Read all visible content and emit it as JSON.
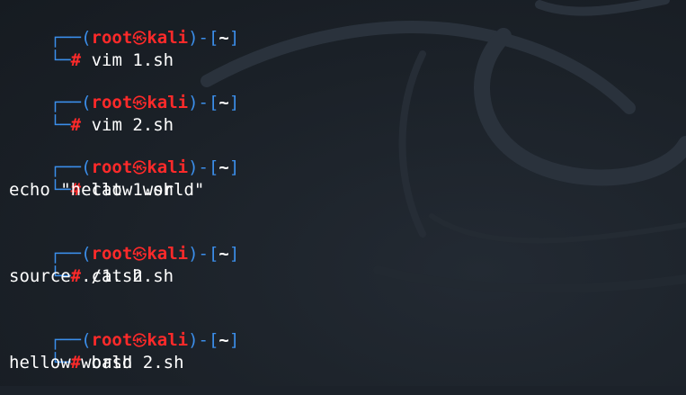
{
  "prompt": {
    "user": "root",
    "host": "kali",
    "dir": "~",
    "symbol": "#",
    "separator": "㉿"
  },
  "session": [
    {
      "command": "vim 1.sh",
      "output": ""
    },
    {
      "command": "vim 2.sh",
      "output": ""
    },
    {
      "command": "cat 1.sh",
      "output": "echo \"hellow world\""
    },
    {
      "command": "cat 2.sh",
      "output": "source ./1.sh"
    },
    {
      "command": "bash 2.sh",
      "output": "hellow world"
    }
  ],
  "colors": {
    "background": "#1c222a",
    "prompt_frame": "#3b8eea",
    "prompt_user": "#ff2a2a",
    "text": "#ffffff"
  }
}
